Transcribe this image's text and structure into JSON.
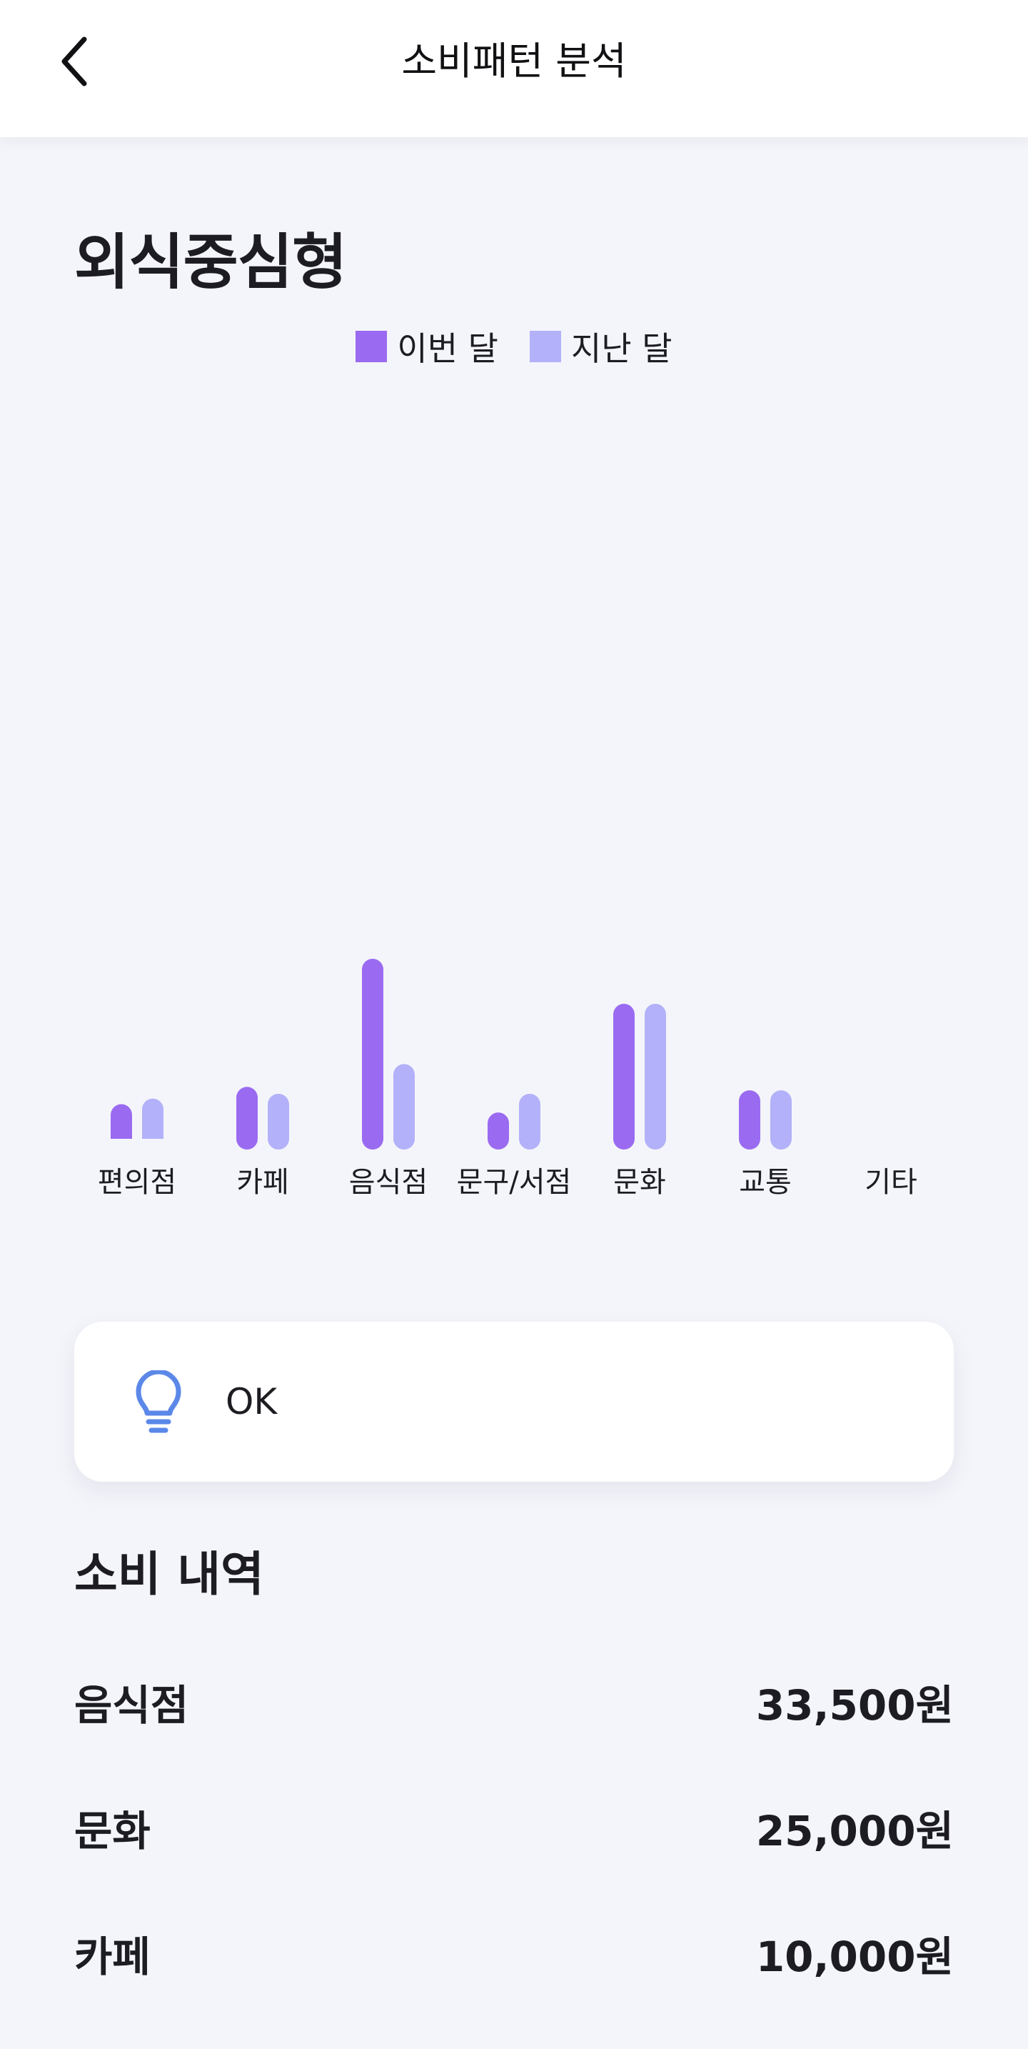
{
  "header": {
    "title": "소비패턴 분석",
    "back_icon": "chevron-left-icon"
  },
  "analysis": {
    "type_title": "외식중심형"
  },
  "legend": {
    "this_month": "이번 달",
    "last_month": "지난 달"
  },
  "colors": {
    "this_month": "#9A6BF1",
    "last_month": "#B3B1F9",
    "tip_icon": "#5B88E8"
  },
  "chart_data": {
    "type": "bar",
    "categories": [
      "편의점",
      "카페",
      "음식점",
      "문구/서점",
      "문화",
      "교통",
      "기타"
    ],
    "series": [
      {
        "name": "이번 달",
        "values": [
          5000,
          7500,
          26000,
          3800,
          19500,
          7000,
          0
        ]
      },
      {
        "name": "지난 달",
        "values": [
          5800,
          6500,
          10800,
          6500,
          19500,
          7000,
          0
        ]
      }
    ],
    "title": "",
    "xlabel": "",
    "ylabel": "",
    "ylim": [
      0,
      26000
    ],
    "grid": false,
    "legend_position": "top-center"
  },
  "tip": {
    "icon": "lightbulb-icon",
    "text": "OK"
  },
  "spending": {
    "title": "소비 내역",
    "items": [
      {
        "category": "음식점",
        "amount": "33,500원"
      },
      {
        "category": "문화",
        "amount": "25,000원"
      },
      {
        "category": "카페",
        "amount": "10,000원"
      }
    ]
  }
}
